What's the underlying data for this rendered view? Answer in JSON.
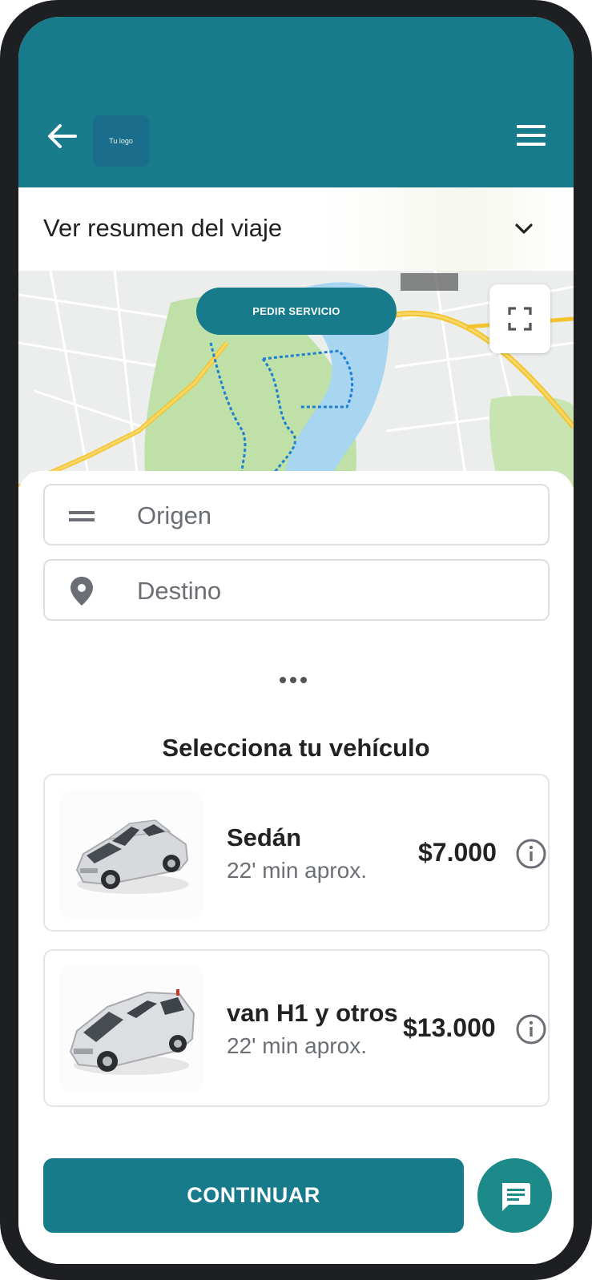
{
  "header": {
    "logo_text": "Tu logo"
  },
  "summary": {
    "label": "Ver resumen del viaje"
  },
  "map": {
    "pedir_button_label": "PEDIR SERVICIO"
  },
  "form": {
    "origin_placeholder": "Origen",
    "destination_placeholder": "Destino"
  },
  "vehicles": {
    "title": "Selecciona tu vehículo",
    "items": [
      {
        "name": "Sedán",
        "eta": "22' min aprox.",
        "price": "$7.000"
      },
      {
        "name": "van H1 y otros",
        "eta": "22' min aprox.",
        "price": "$13.000"
      }
    ]
  },
  "actions": {
    "continue_label": "CONTINUAR"
  },
  "colors": {
    "primary": "#177b8b",
    "chat": "#1b8a88",
    "frame": "#1e1f22"
  },
  "icons": [
    "back-arrow-icon",
    "hamburger-menu-icon",
    "chevron-down-icon",
    "fullscreen-icon",
    "drag-handle-icon",
    "location-pin-icon",
    "more-dots-icon",
    "info-icon",
    "chat-icon"
  ]
}
